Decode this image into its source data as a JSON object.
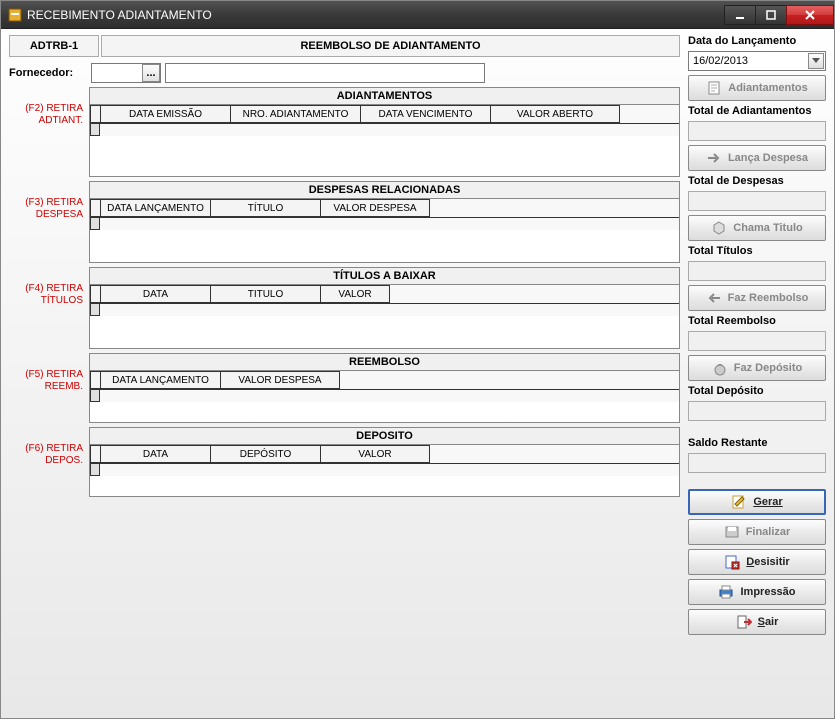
{
  "window": {
    "title": "RECEBIMENTO ADIANTAMENTO"
  },
  "header": {
    "code": "ADTRB-1",
    "title": "REEMBOLSO DE ADIANTAMENTO"
  },
  "fornecedor": {
    "label": "Fornecedor:",
    "lookup_btn": "..."
  },
  "sections": {
    "adiantamentos": {
      "label_l1": "(F2) RETIRA",
      "label_l2": "ADTIANT.",
      "title": "ADIANTAMENTOS",
      "cols": [
        "DATA EMISSÃO",
        "NRO. ADIANTAMENTO",
        "DATA VENCIMENTO",
        "VALOR ABERTO"
      ]
    },
    "despesas": {
      "label_l1": "(F3) RETIRA",
      "label_l2": "DESPESA",
      "title": "DESPESAS RELACIONADAS",
      "cols": [
        "DATA LANÇAMENTO",
        "TÍTULO",
        "VALOR DESPESA"
      ]
    },
    "titulos": {
      "label_l1": "(F4) RETIRA",
      "label_l2": "TÍTULOS",
      "title": "TÍTULOS A BAIXAR",
      "cols": [
        "DATA",
        "TITULO",
        "VALOR"
      ]
    },
    "reembolso": {
      "label_l1": "(F5) RETIRA",
      "label_l2": "REEMB.",
      "title": "REEMBOLSO",
      "cols": [
        "DATA LANÇAMENTO",
        "VALOR DESPESA"
      ]
    },
    "deposito": {
      "label_l1": "(F6) RETIRA",
      "label_l2": "DEPOS.",
      "title": "DEPOSITO",
      "cols": [
        "DATA",
        "DEPÓSITO",
        "VALOR"
      ]
    }
  },
  "side": {
    "date_label": "Data do Lançamento",
    "date_value": "16/02/2013",
    "btn_adiant": "Adiantamentos",
    "total_adiant": "Total de Adiantamentos",
    "btn_lanca": "Lança Despesa",
    "total_despesas": "Total de Despesas",
    "btn_chama": "Chama Titulo",
    "total_titulos": "Total Títulos",
    "btn_reemb": "Faz Reembolso",
    "total_reemb": "Total Reembolso",
    "btn_depo": "Faz Depósito",
    "total_depo": "Total Depósito",
    "saldo": "Saldo Restante",
    "btn_gerar": "Gerar",
    "btn_finalizar": "Finalizar",
    "btn_desistir": "Desisitir",
    "btn_impressao": "Impressão",
    "btn_sair": "Sair"
  }
}
